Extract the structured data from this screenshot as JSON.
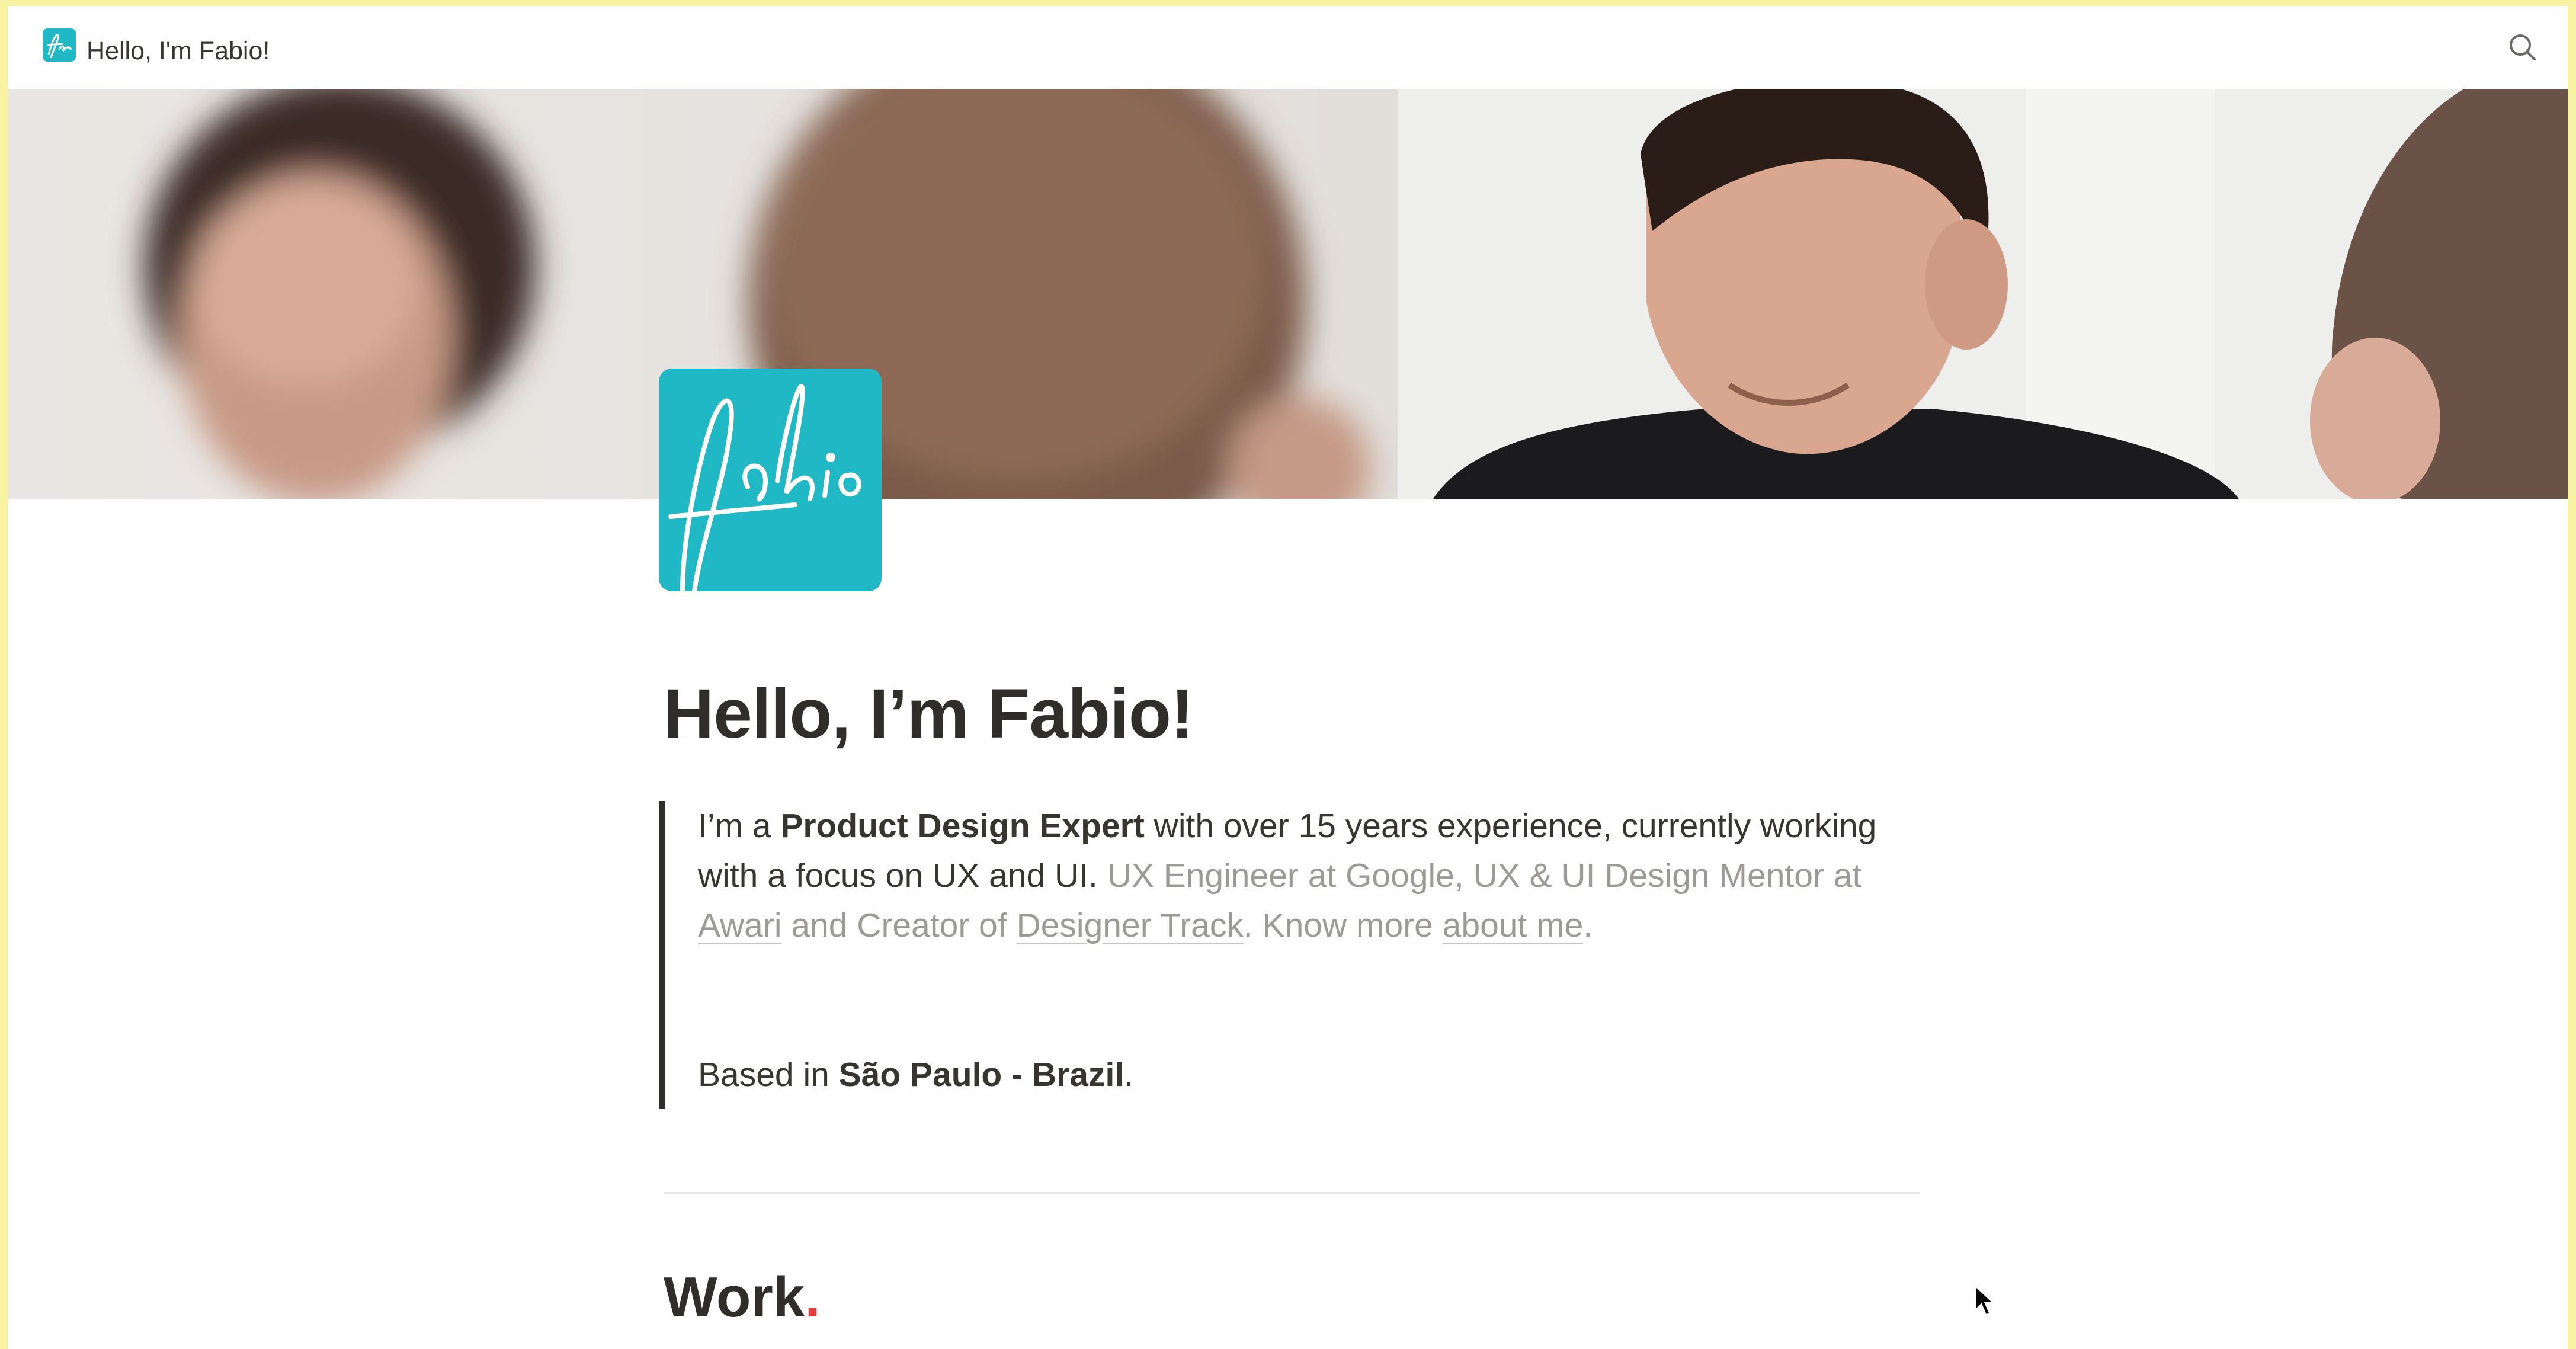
{
  "topbar": {
    "title": "Hello, I'm Fabio!",
    "favicon_icon": "fabio-logo-icon",
    "search_icon": "search-icon"
  },
  "cover": {
    "description_icon": "cover-photo-image"
  },
  "page_icon": {
    "logo_text": "fabio",
    "color": "#1fb8c4"
  },
  "heading": "Hello, I’m Fabio!",
  "intro": {
    "t1": "I’m a ",
    "bold1": "Product Design Expert",
    "t2": " with over 15 years experience, currently working with a focus on UX and UI. ",
    "muted1": "UX Engineer at Google, UX & UI Design Mentor at ",
    "link_awari": "Awari",
    "muted2": " and Creator of ",
    "link_designer_track": "Designer Track",
    "muted3": ". Know more ",
    "link_about": "about me",
    "muted4": "."
  },
  "location": {
    "t1": "Based in ",
    "bold": "São Paulo - Brazil",
    "t2": "."
  },
  "work": {
    "title": "Work",
    "dot": "."
  },
  "colors": {
    "accent_teal": "#1fb8c4",
    "text": "#37352f",
    "muted": "#9b9a97",
    "red_dot": "#e03e3e",
    "frame_border": "#f8f3a4"
  }
}
